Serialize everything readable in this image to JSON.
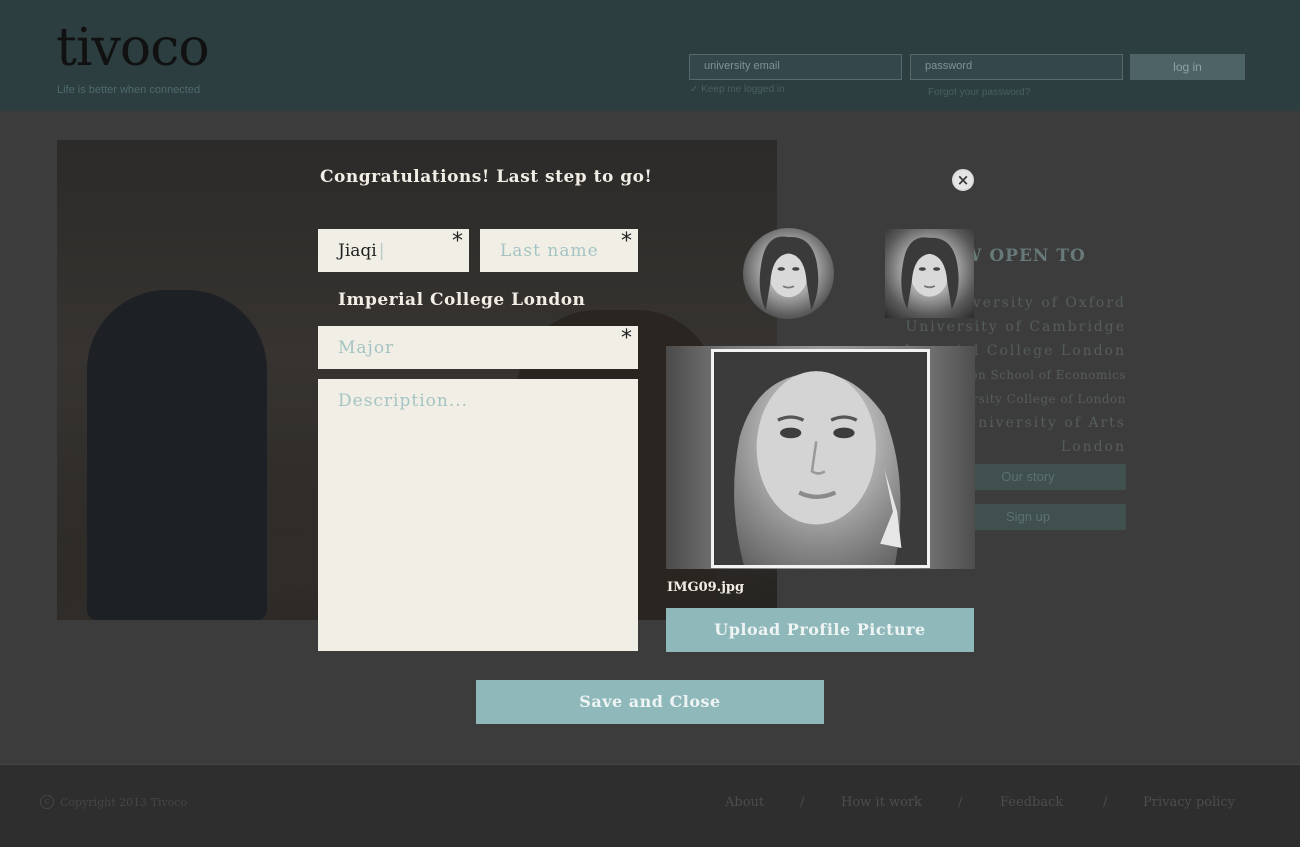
{
  "header": {
    "logo": "tivoco",
    "tagline": "Life is better when connected",
    "login": {
      "email_placeholder": "university email",
      "password_placeholder": "password",
      "login_label": "log in",
      "keep_logged_in": "Keep me logged in",
      "forgot_password": "Forgot your password?"
    }
  },
  "sidebar": {
    "title": "NOW OPEN TO",
    "universities": [
      "University of Oxford",
      "University of Cambridge",
      "Imperial College London",
      "London School of Economics",
      "University College of London",
      "University of Arts London"
    ],
    "buttons": [
      "Our story",
      "Sign up"
    ]
  },
  "modal": {
    "title": "Congratulations! Last step to go!",
    "first_name_value": "Jiaqi",
    "last_name_placeholder": "Last name",
    "school": "Imperial College London",
    "major_placeholder": "Major",
    "description_placeholder": "Description...",
    "required_mark": "*",
    "close_symbol": "×",
    "file_name": "IMG09.jpg",
    "upload_label": "Upload Profile Picture",
    "save_label": "Save and Close"
  },
  "footer": {
    "copyright": "Copyright 2013 Tivoco",
    "links": [
      "About",
      "How it work",
      "Feedback",
      "Privacy policy"
    ],
    "separator": "/"
  },
  "colors": {
    "accent": "#8fb8bb",
    "field_bg": "#f1eee6",
    "placeholder": "#a4c4c3"
  }
}
